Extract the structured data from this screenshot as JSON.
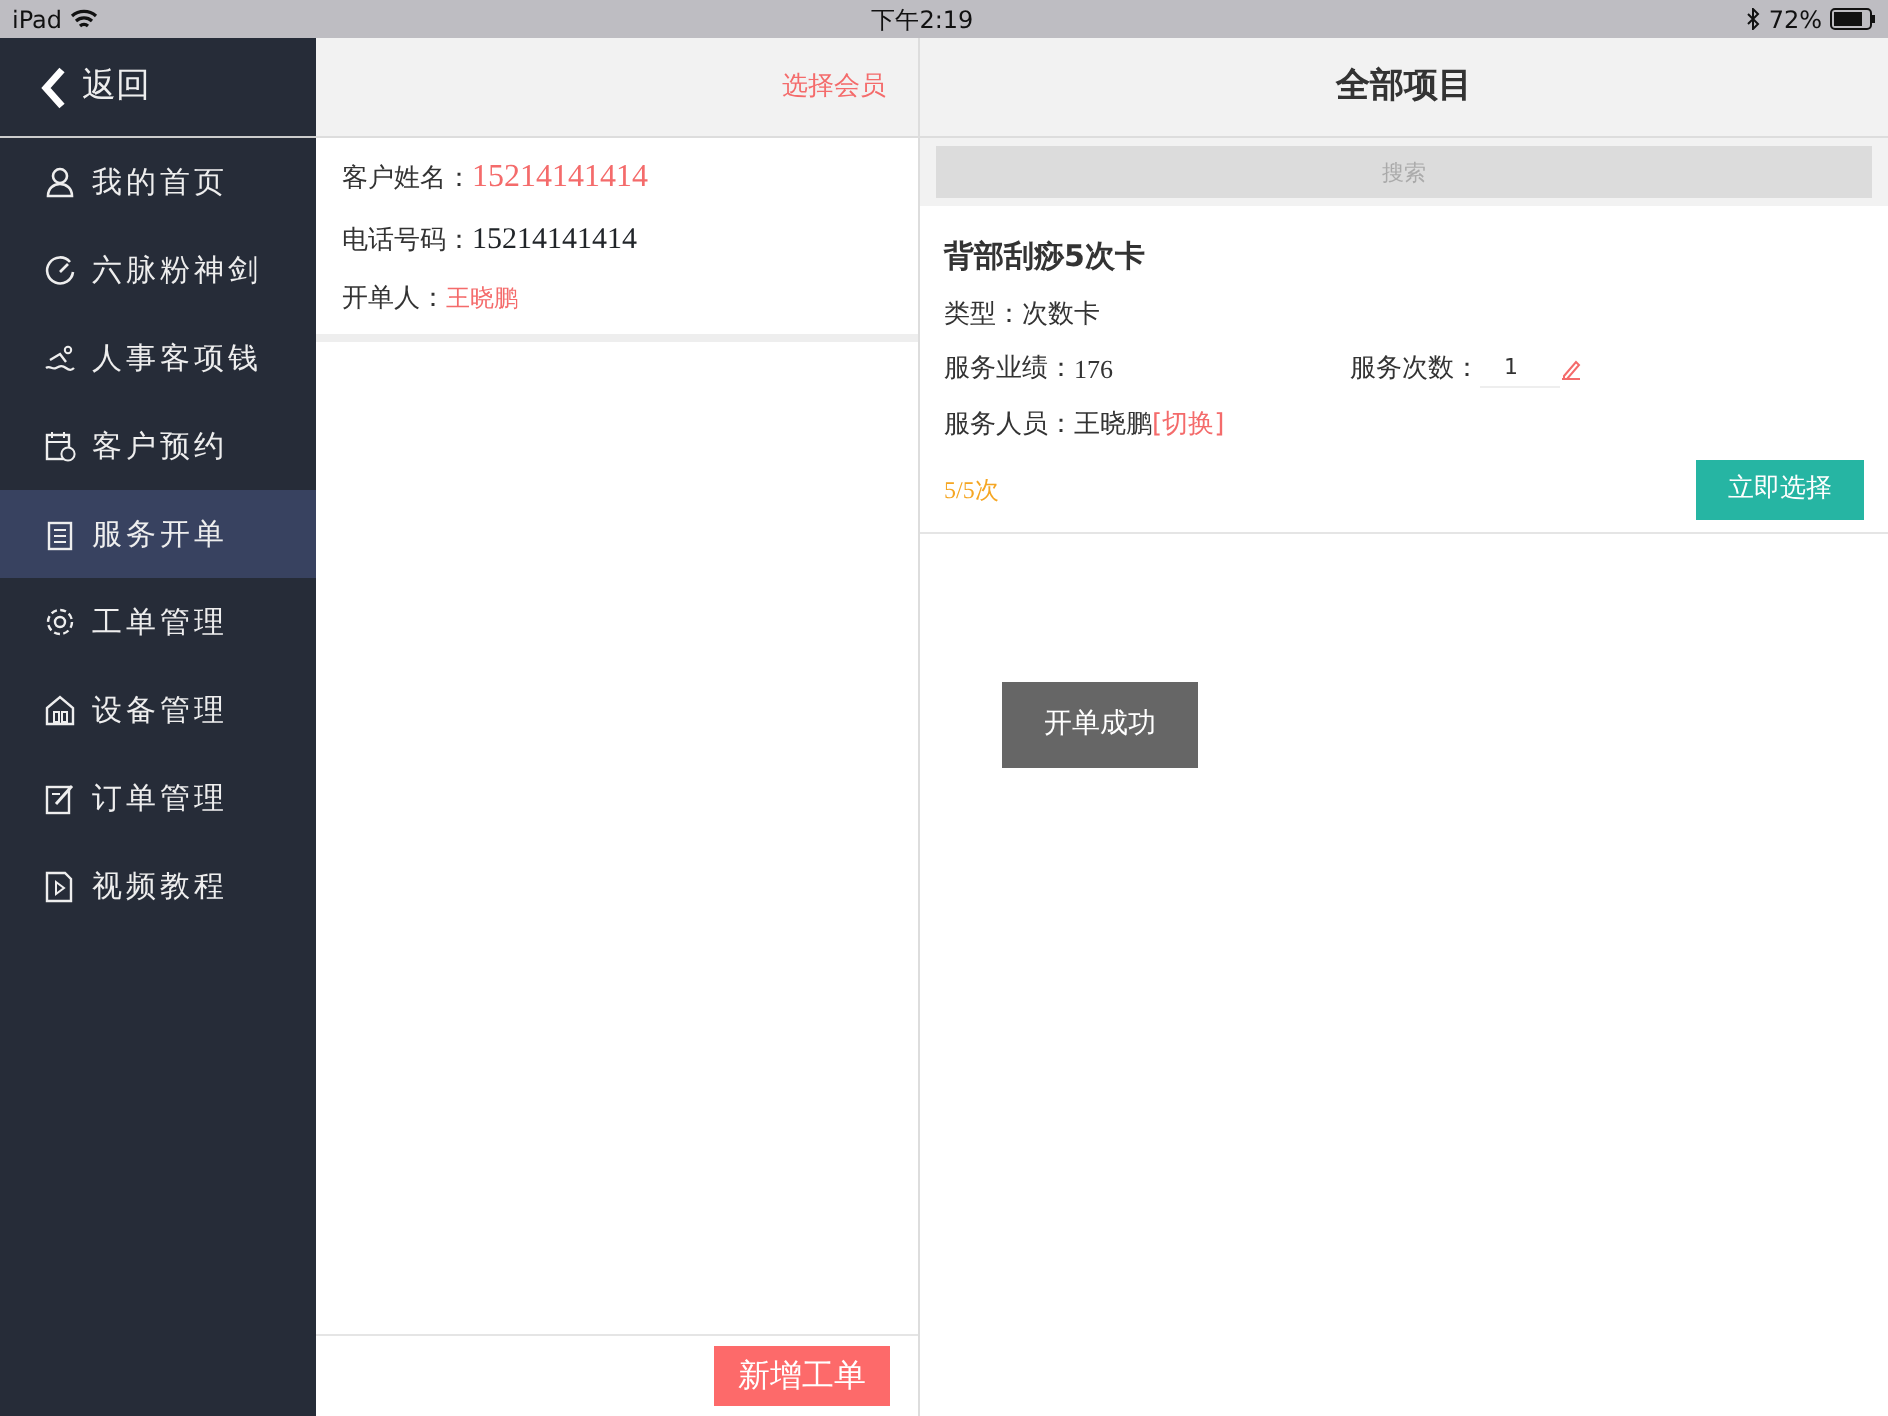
{
  "status_bar": {
    "device": "iPad",
    "time": "下午2:19",
    "battery": "72%"
  },
  "sidebar": {
    "back": "返回",
    "items": [
      {
        "label": "我的首页",
        "selected": false
      },
      {
        "label": "六脉粉神剑",
        "selected": false
      },
      {
        "label": "人事客项钱",
        "selected": false
      },
      {
        "label": "客户预约",
        "selected": false
      },
      {
        "label": "服务开单",
        "selected": true
      },
      {
        "label": "工单管理",
        "selected": false
      },
      {
        "label": "设备管理",
        "selected": false
      },
      {
        "label": "订单管理",
        "selected": false
      },
      {
        "label": "视频教程",
        "selected": false
      }
    ]
  },
  "member_panel": {
    "action": "选择会员",
    "customer_name_label": "客户姓名：",
    "customer_name": "15214141414",
    "phone_label": "电话号码：",
    "phone": "15214141414",
    "creator_label": "开单人：",
    "creator": "王晓鹏",
    "add_button": "新增工单"
  },
  "projects": {
    "title": "全部项目",
    "search": {
      "placeholder": "搜索"
    },
    "items": [
      {
        "name": "背部刮痧5次卡",
        "type_label": "类型：",
        "type": "次数卡",
        "performance_label": "服务业绩：",
        "performance": "176",
        "count_label": "服务次数：",
        "count": "1",
        "staff_label": "服务人员：",
        "staff": "王晓鹏",
        "switch": "[切换]",
        "remaining": "5/5次",
        "select_button": "立即选择"
      }
    ]
  },
  "toast": "开单成功"
}
